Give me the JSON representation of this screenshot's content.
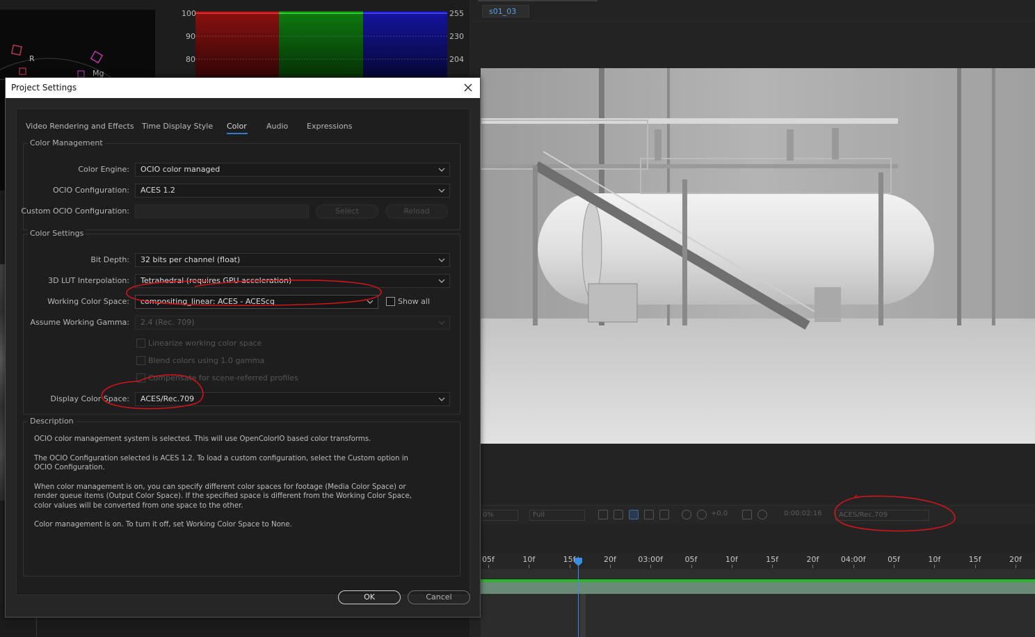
{
  "scopes": {
    "vectorscope_labels": [
      "R",
      "Mg"
    ],
    "parade_left_ticks": [
      "100",
      "90",
      "80"
    ],
    "parade_right_ticks": [
      "255",
      "230",
      "204"
    ]
  },
  "composition": {
    "tab_label": "s01_03"
  },
  "viewer_toolbar": {
    "zoom": "0%",
    "resolution": "Full",
    "exposure": "+0,0",
    "timecode": "0:00:02:16",
    "display_color_space": "ACES/Rec.709"
  },
  "timeline": {
    "ruler_labels": [
      "05f",
      "10f",
      "15f",
      "20f",
      "03:00f",
      "05f",
      "10f",
      "15f",
      "20f",
      "04:00f",
      "05f",
      "10f",
      "15f",
      "20f"
    ]
  },
  "dialog": {
    "title": "Project Settings",
    "tabs": [
      {
        "label": "Video Rendering and Effects",
        "active": false
      },
      {
        "label": "Time Display Style",
        "active": false
      },
      {
        "label": "Color",
        "active": true
      },
      {
        "label": "Audio",
        "active": false
      },
      {
        "label": "Expressions",
        "active": false
      }
    ],
    "color_management": {
      "title": "Color Management",
      "color_engine_label": "Color Engine:",
      "color_engine_value": "OCIO color managed",
      "ocio_config_label": "OCIO Configuration:",
      "ocio_config_value": "ACES 1.2",
      "custom_ocio_label": "Custom OCIO Configuration:",
      "custom_ocio_value": "",
      "select_label": "Select",
      "reload_label": "Reload"
    },
    "color_settings": {
      "title": "Color Settings",
      "bit_depth_label": "Bit Depth:",
      "bit_depth_value": "32 bits per channel (float)",
      "lut_label": "3D LUT Interpolation:",
      "lut_value": "Tetrahedral (requires GPU acceleration)",
      "working_space_label": "Working Color Space:",
      "working_space_value": "compositing_linear: ACES - ACEScg",
      "show_all_label": "Show all",
      "show_all_checked": false,
      "gamma_label": "Assume Working Gamma:",
      "gamma_value": "2.4 (Rec. 709)",
      "linearize_label": "Linearize working color space",
      "blend_label": "Blend colors using 1.0 gamma",
      "compensate_label": "Compensate for scene-referred profiles",
      "display_space_label": "Display Color Space:",
      "display_space_value": "ACES/Rec.709"
    },
    "description": {
      "title": "Description",
      "paragraphs": [
        "OCIO color management system is selected. This will use OpenColorIO based color transforms.",
        "The OCIO Configuration selected is ACES 1.2. To load a custom configuration, select the Custom option in\nOCIO Configuration.",
        "When color management is on, you can specify different color spaces for footage (Media Color Space) or\nrender queue items (Output Color Space). If the specified space is different from the Working Color Space,\ncolor values will be converted from one space to the other.",
        "Color management is on. To turn it off, set Working Color Space to None."
      ]
    },
    "ok_label": "OK",
    "cancel_label": "Cancel"
  },
  "colors": {
    "annotation_red": "#d0151b",
    "accent_blue": "#2f7fd0",
    "timeline_green": "#2bb52b"
  }
}
